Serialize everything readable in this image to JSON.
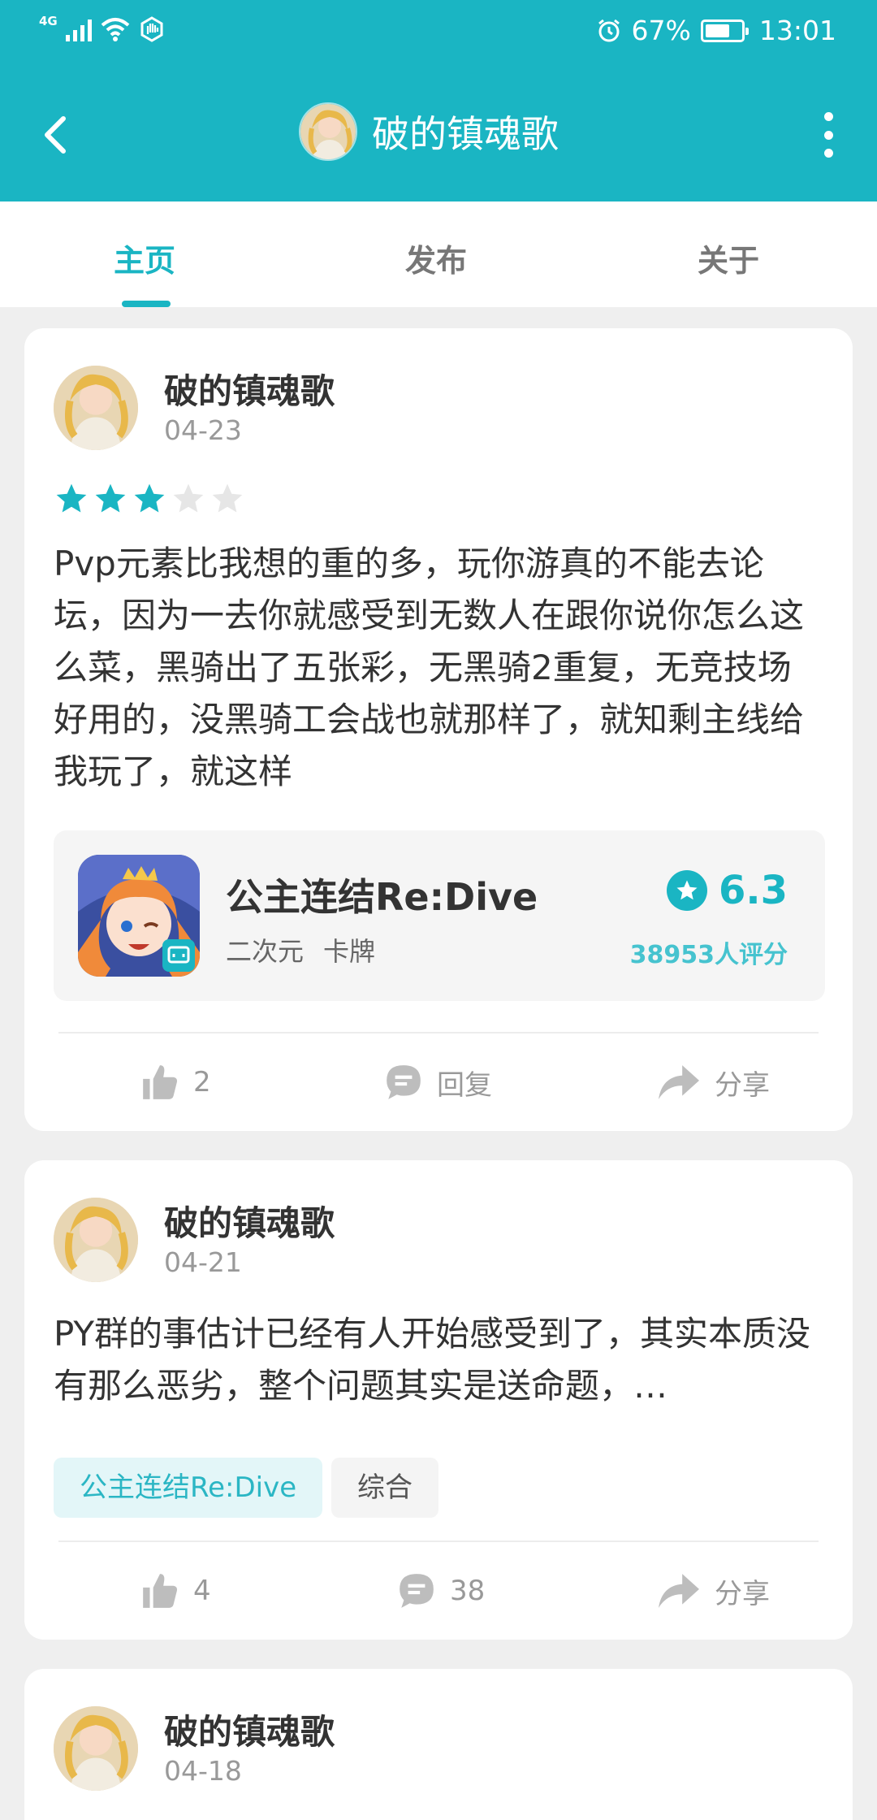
{
  "status_bar": {
    "network": "4G",
    "battery": "67%",
    "time": "13:01",
    "battery_level": 0.67
  },
  "header": {
    "title": "破的镇魂歌"
  },
  "tabs": [
    {
      "label": "主页",
      "active": true
    },
    {
      "label": "发布",
      "active": false
    },
    {
      "label": "关于",
      "active": false
    }
  ],
  "posts": [
    {
      "author": "破的镇魂歌",
      "date": "04-23",
      "rating": 3,
      "content": "Pvp元素比我想的重的多，玩你游真的不能去论坛，因为一去你就感受到无数人在跟你说你怎么这么菜，黑骑出了五张彩，无黑骑2重复，无竞技场好用的，没黑骑工会战也就那样了，就知剩主线给我玩了，就这样",
      "game": {
        "name": "公主连结Re:Dive",
        "tags": [
          "二次元",
          "卡牌"
        ],
        "score": "6.3",
        "raters": "38953人评分"
      },
      "likes": "2",
      "reply_label": "回复",
      "share_label": "分享"
    },
    {
      "author": "破的镇魂歌",
      "date": "04-21",
      "content": "PY群的事估计已经有人开始感受到了，其实本质没有那么恶劣，整个问题其实是送命题，…",
      "tags": [
        "公主连结Re:Dive",
        "综合"
      ],
      "likes": "4",
      "comments": "38",
      "share_label": "分享"
    },
    {
      "author": "破的镇魂歌",
      "date": "04-18"
    }
  ],
  "colors": {
    "accent": "#1ab5c3",
    "background": "#efefef"
  }
}
